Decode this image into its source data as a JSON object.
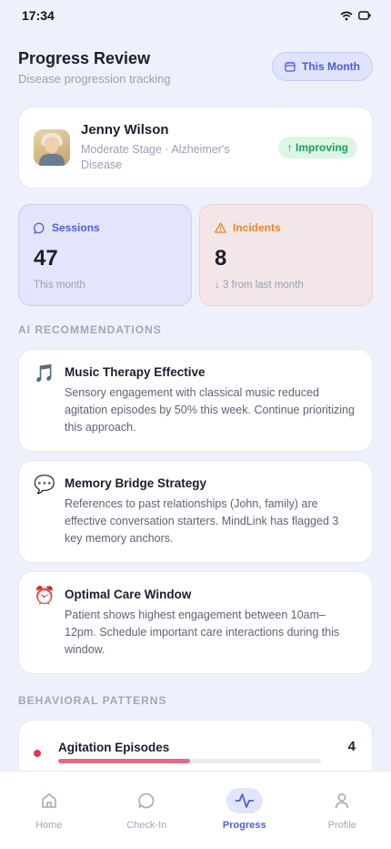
{
  "status_bar": {
    "time": "17:34"
  },
  "header": {
    "title": "Progress Review",
    "subtitle": "Disease progression tracking",
    "period_button": "This Month"
  },
  "patient": {
    "name": "Jenny Wilson",
    "stage": "Moderate Stage · Alzheimer's Disease",
    "status": "↑ Improving"
  },
  "stats": {
    "sessions": {
      "label": "Sessions",
      "value": "47",
      "note": "This month"
    },
    "incidents": {
      "label": "Incidents",
      "value": "8",
      "note": "↓ 3 from last month"
    }
  },
  "recommendations": {
    "section_title": "AI RECOMMENDATIONS",
    "items": [
      {
        "icon": "🎵",
        "title": "Music Therapy Effective",
        "text": "Sensory engagement with classical music reduced agitation episodes by 50% this week. Continue prioritizing this approach."
      },
      {
        "icon": "💬",
        "title": "Memory Bridge Strategy",
        "text": "References to past relationships (John, family) are effective conversation starters. MindLink has flagged 3 key memory anchors."
      },
      {
        "icon": "⏰",
        "title": "Optimal Care Window",
        "text": "Patient shows highest engagement between 10am–12pm. Schedule important care interactions during this window."
      }
    ]
  },
  "patterns": {
    "section_title": "BEHAVIORAL PATTERNS",
    "items": [
      {
        "label": "Agitation Episodes",
        "count": "4",
        "level": 0.5,
        "color": "#e36a84"
      }
    ]
  },
  "nav": {
    "items": [
      {
        "label": "Home",
        "icon": "home-icon"
      },
      {
        "label": "Check-In",
        "icon": "chat-icon"
      },
      {
        "label": "Progress",
        "icon": "activity-icon"
      },
      {
        "label": "Profile",
        "icon": "user-icon"
      }
    ],
    "active": "Progress"
  },
  "colors": {
    "accent": "#4f5fd8",
    "success": "#1f9d57",
    "warning": "#e4882c",
    "danger": "#e0394f"
  }
}
